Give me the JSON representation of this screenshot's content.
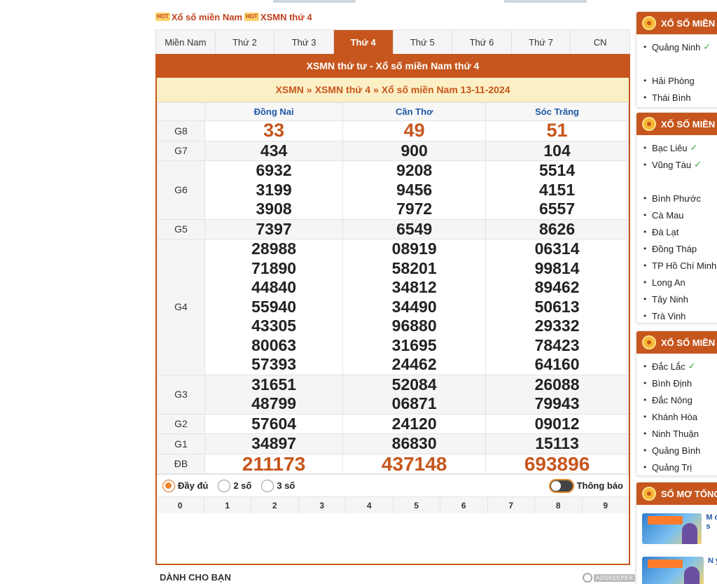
{
  "header": {
    "hot_badge": "HOT",
    "crumb_1": "Xổ số miền Nam",
    "crumb_2": "XSMN thứ 4"
  },
  "tabs": [
    {
      "label": "Miền Nam",
      "active": false
    },
    {
      "label": "Thứ 2",
      "active": false
    },
    {
      "label": "Thứ 3",
      "active": false
    },
    {
      "label": "Thứ 4",
      "active": true
    },
    {
      "label": "Thứ 5",
      "active": false
    },
    {
      "label": "Thứ 6",
      "active": false
    },
    {
      "label": "Thứ 7",
      "active": false
    },
    {
      "label": "CN",
      "active": false
    }
  ],
  "panel": {
    "title": "XSMN thứ tư - Xổ số miền Nam thứ 4",
    "breadcrumb": [
      "XSMN",
      "XSMN thứ 4",
      "Xổ số miền Nam 13-11-2024"
    ],
    "breadcrumb_sep": "»"
  },
  "provinces": [
    "Đồng Nai",
    "Cần Thơ",
    "Sóc Trăng"
  ],
  "results": [
    {
      "prize": "G8",
      "values": [
        [
          "33"
        ],
        [
          "49"
        ],
        [
          "51"
        ]
      ],
      "style": "red"
    },
    {
      "prize": "G7",
      "values": [
        [
          "434"
        ],
        [
          "900"
        ],
        [
          "104"
        ]
      ]
    },
    {
      "prize": "G6",
      "values": [
        [
          "6932",
          "3199",
          "3908"
        ],
        [
          "9208",
          "9456",
          "7972"
        ],
        [
          "5514",
          "4151",
          "6557"
        ]
      ]
    },
    {
      "prize": "G5",
      "values": [
        [
          "7397"
        ],
        [
          "6549"
        ],
        [
          "8626"
        ]
      ]
    },
    {
      "prize": "G4",
      "values": [
        [
          "28988",
          "71890",
          "44840",
          "55940",
          "43305",
          "80063",
          "57393"
        ],
        [
          "08919",
          "58201",
          "34812",
          "34490",
          "96880",
          "31695",
          "24462"
        ],
        [
          "06314",
          "99814",
          "89462",
          "50613",
          "29332",
          "78423",
          "64160"
        ]
      ]
    },
    {
      "prize": "G3",
      "values": [
        [
          "31651",
          "48799"
        ],
        [
          "52084",
          "06871"
        ],
        [
          "26088",
          "79943"
        ]
      ]
    },
    {
      "prize": "G2",
      "values": [
        [
          "57604"
        ],
        [
          "24120"
        ],
        [
          "09012"
        ]
      ]
    },
    {
      "prize": "G1",
      "values": [
        [
          "34897"
        ],
        [
          "86830"
        ],
        [
          "15113"
        ]
      ]
    },
    {
      "prize": "ĐB",
      "values": [
        [
          "211173"
        ],
        [
          "437148"
        ],
        [
          "693896"
        ]
      ],
      "style": "big"
    }
  ],
  "options": {
    "full_label": "Đầy đủ",
    "two_label": "2 số",
    "three_label": "3 số",
    "selected": "Đầy đủ",
    "notify_label": "Thông báo"
  },
  "digits": [
    "0",
    "1",
    "2",
    "3",
    "4",
    "5",
    "6",
    "7",
    "8",
    "9"
  ],
  "for_you": "DÀNH CHO BẠN",
  "ad_label": "ADSKEEPER",
  "sidebar": {
    "box1": {
      "title": "XỔ SỐ MIỀN BẮC",
      "items": [
        {
          "label": "Quảng Ninh",
          "done": true
        },
        {
          "label": "",
          "gap": true
        },
        {
          "label": "Hải Phòng",
          "done": false
        },
        {
          "label": "Thái Bình",
          "done": false
        }
      ]
    },
    "box2": {
      "title": "XỔ SỐ MIỀN NAM",
      "items": [
        {
          "label": "Bạc Liêu",
          "done": true
        },
        {
          "label": "Vũng Tàu",
          "done": true
        },
        {
          "label": "",
          "gap": true
        },
        {
          "label": "Bình Phước",
          "done": false
        },
        {
          "label": "Cà Mau",
          "done": false
        },
        {
          "label": "Đà Lạt",
          "done": false
        },
        {
          "label": "Đồng Tháp",
          "done": false
        },
        {
          "label": "TP Hồ Chí Minh",
          "done": false
        },
        {
          "label": "Long An",
          "done": false
        },
        {
          "label": "Tây Ninh",
          "done": false
        },
        {
          "label": "Trà Vinh",
          "done": false
        }
      ]
    },
    "box3": {
      "title": "XỔ SỐ MIỀN TRUNG",
      "items": [
        {
          "label": "Đắc Lắc",
          "done": true
        },
        {
          "label": "Bình Định",
          "done": false
        },
        {
          "label": "Đắc Nông",
          "done": false
        },
        {
          "label": "Khánh Hòa",
          "done": false
        },
        {
          "label": "Ninh Thuận",
          "done": false
        },
        {
          "label": "Quảng Bình",
          "done": false
        },
        {
          "label": "Quảng Trị",
          "done": false
        }
      ]
    },
    "box4": {
      "title": "SỔ MƠ TỔNG HỢP",
      "items": [
        {
          "text": "M c s"
        },
        {
          "text": "N ý"
        }
      ]
    }
  },
  "colors": {
    "brand": "#c6561d",
    "province_header": "#1f57a6",
    "crumb_bg": "#fcefc5",
    "check": "#3aa53a"
  }
}
